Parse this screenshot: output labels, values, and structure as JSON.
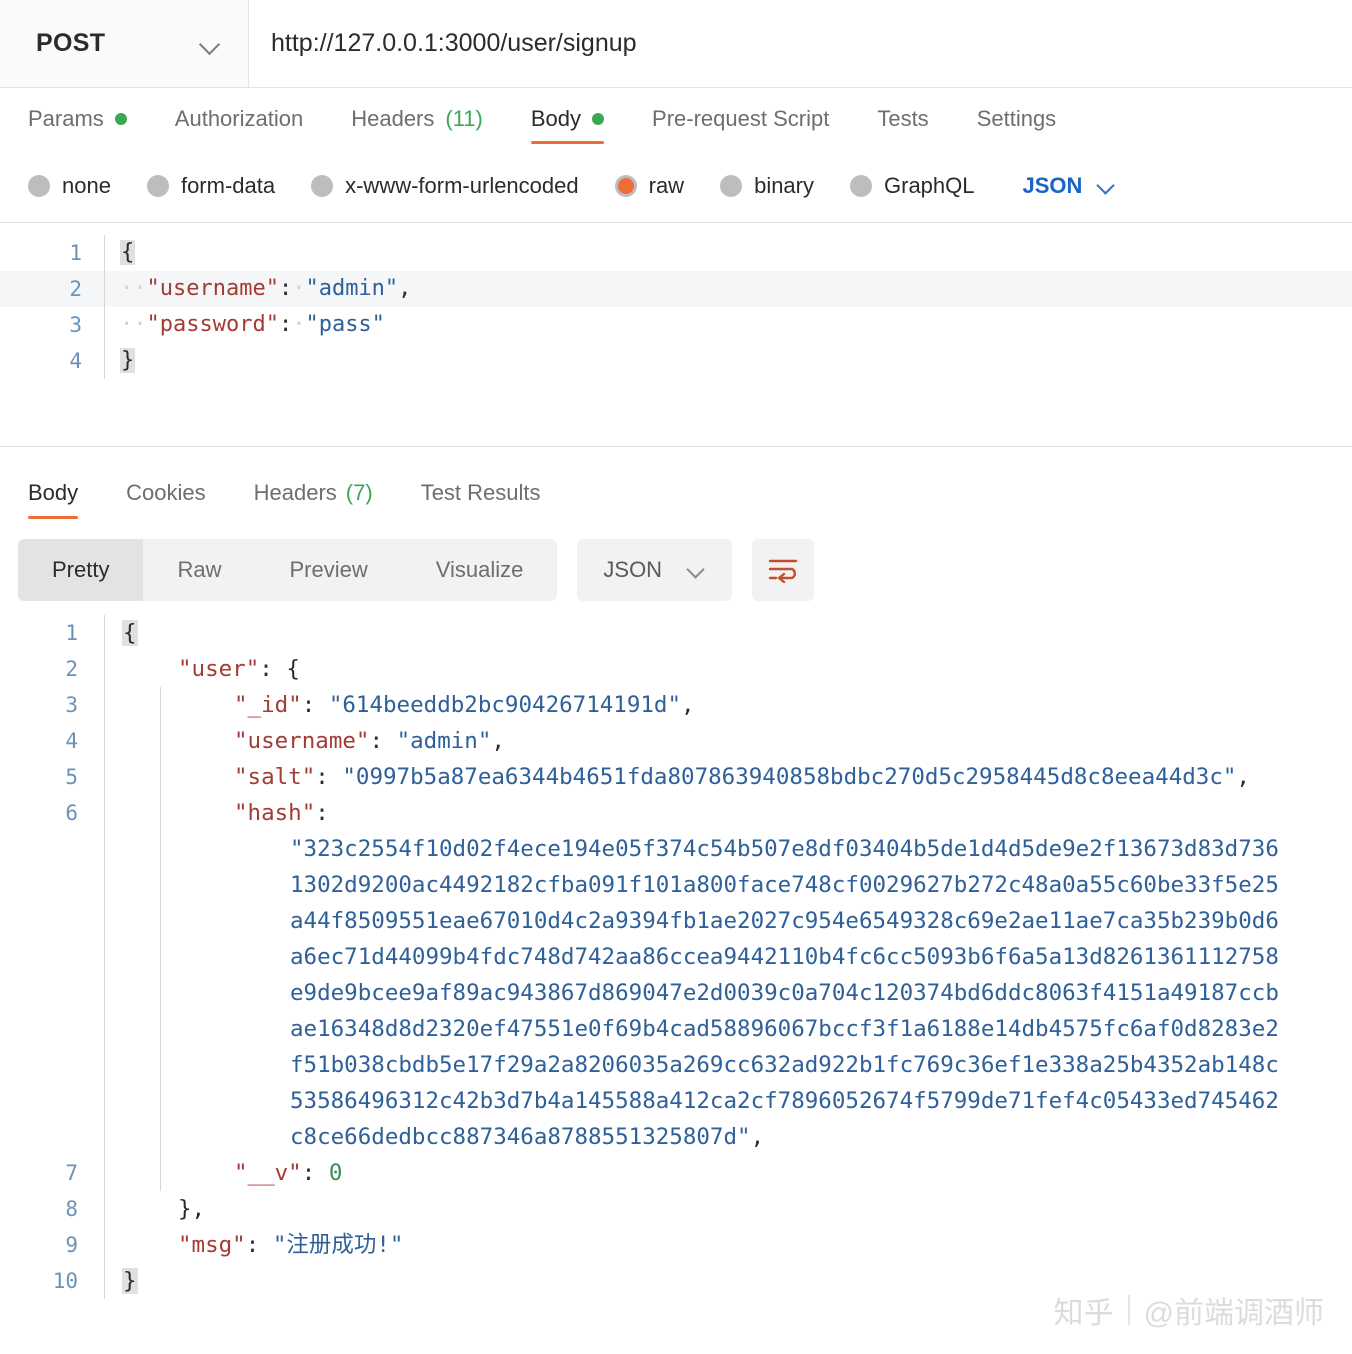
{
  "request": {
    "method": "POST",
    "url": "http://127.0.0.1:3000/user/signup",
    "tabs": [
      {
        "label": "Params",
        "indicator": "dot",
        "active": false
      },
      {
        "label": "Authorization",
        "indicator": "none",
        "active": false
      },
      {
        "label": "Headers",
        "count": "(11)",
        "indicator": "count",
        "active": false
      },
      {
        "label": "Body",
        "indicator": "dot",
        "active": true
      },
      {
        "label": "Pre-request Script",
        "indicator": "none",
        "active": false
      },
      {
        "label": "Tests",
        "indicator": "none",
        "active": false
      },
      {
        "label": "Settings",
        "indicator": "none",
        "active": false
      }
    ],
    "body_types": [
      {
        "label": "none",
        "selected": false
      },
      {
        "label": "form-data",
        "selected": false
      },
      {
        "label": "x-www-form-urlencoded",
        "selected": false
      },
      {
        "label": "raw",
        "selected": true
      },
      {
        "label": "binary",
        "selected": false
      },
      {
        "label": "GraphQL",
        "selected": false
      }
    ],
    "raw_format": "JSON",
    "editor_lines": [
      {
        "num": "1",
        "tokens": [
          {
            "t": "{",
            "c": "fold"
          }
        ]
      },
      {
        "num": "2",
        "highlight": true,
        "tokens": [
          {
            "t": "··",
            "c": "ws"
          },
          {
            "t": "\"username\"",
            "c": "k"
          },
          {
            "t": ":",
            "c": "p"
          },
          {
            "t": "·",
            "c": "ws"
          },
          {
            "t": "\"admin\"",
            "c": "s"
          },
          {
            "t": ",",
            "c": "p"
          }
        ]
      },
      {
        "num": "3",
        "tokens": [
          {
            "t": "··",
            "c": "ws"
          },
          {
            "t": "\"password\"",
            "c": "k"
          },
          {
            "t": ":",
            "c": "p"
          },
          {
            "t": "·",
            "c": "ws"
          },
          {
            "t": "\"pass\"",
            "c": "s"
          }
        ]
      },
      {
        "num": "4",
        "tokens": [
          {
            "t": "}",
            "c": "fold"
          }
        ]
      }
    ]
  },
  "response": {
    "tabs": [
      {
        "label": "Body",
        "active": true
      },
      {
        "label": "Cookies",
        "active": false
      },
      {
        "label": "Headers",
        "count": "(7)",
        "active": false
      },
      {
        "label": "Test Results",
        "active": false
      }
    ],
    "view_modes": [
      {
        "label": "Pretty",
        "active": true
      },
      {
        "label": "Raw",
        "active": false
      },
      {
        "label": "Preview",
        "active": false
      },
      {
        "label": "Visualize",
        "active": false
      }
    ],
    "format": "JSON",
    "wrap_icon": "word-wrap-icon",
    "accent_color": "#ef6c34",
    "lines": [
      {
        "num": "1",
        "indent": 0,
        "level": 0,
        "tokens": [
          {
            "t": "{",
            "c": "fold"
          }
        ]
      },
      {
        "num": "2",
        "indent": 1,
        "level": 1,
        "tokens": [
          {
            "t": "\"user\"",
            "c": "k"
          },
          {
            "t": ": {",
            "c": "p"
          }
        ]
      },
      {
        "num": "3",
        "indent": 2,
        "level": 2,
        "tokens": [
          {
            "t": "\"_id\"",
            "c": "k"
          },
          {
            "t": ": ",
            "c": "p"
          },
          {
            "t": "\"614beeddb2bc90426714191d\"",
            "c": "s"
          },
          {
            "t": ",",
            "c": "p"
          }
        ]
      },
      {
        "num": "4",
        "indent": 2,
        "level": 2,
        "tokens": [
          {
            "t": "\"username\"",
            "c": "k"
          },
          {
            "t": ": ",
            "c": "p"
          },
          {
            "t": "\"admin\"",
            "c": "s"
          },
          {
            "t": ",",
            "c": "p"
          }
        ]
      },
      {
        "num": "5",
        "indent": 2,
        "level": 2,
        "tokens": [
          {
            "t": "\"salt\"",
            "c": "k"
          },
          {
            "t": ": ",
            "c": "p"
          },
          {
            "t": "\"0997b5a87ea6344b4651fda807863940858bdbc270d5c2958445d8c8eea44d3c\"",
            "c": "s"
          },
          {
            "t": ",",
            "c": "p"
          }
        ]
      },
      {
        "num": "6",
        "indent": 2,
        "level": 2,
        "tokens": [
          {
            "t": "\"hash\"",
            "c": "k"
          },
          {
            "t": ":",
            "c": "p"
          }
        ]
      },
      {
        "num": "",
        "indent": 3,
        "level": 2,
        "tokens": [
          {
            "t": "\"323c2554f10d02f4ece194e05f374c54b507e8df03404b5de1d4d5de9e2f13673d83d736",
            "c": "s"
          }
        ]
      },
      {
        "num": "",
        "indent": 3,
        "level": 2,
        "tokens": [
          {
            "t": "1302d9200ac4492182cfba091f101a800face748cf0029627b272c48a0a55c60be33f5e25",
            "c": "s"
          }
        ]
      },
      {
        "num": "",
        "indent": 3,
        "level": 2,
        "tokens": [
          {
            "t": "a44f8509551eae67010d4c2a9394fb1ae2027c954e6549328c69e2ae11ae7ca35b239b0d6",
            "c": "s"
          }
        ]
      },
      {
        "num": "",
        "indent": 3,
        "level": 2,
        "tokens": [
          {
            "t": "a6ec71d44099b4fdc748d742aa86ccea9442110b4fc6cc5093b6f6a5a13d8261361112758",
            "c": "s"
          }
        ]
      },
      {
        "num": "",
        "indent": 3,
        "level": 2,
        "tokens": [
          {
            "t": "e9de9bcee9af89ac943867d869047e2d0039c0a704c120374bd6ddc8063f4151a49187ccb",
            "c": "s"
          }
        ]
      },
      {
        "num": "",
        "indent": 3,
        "level": 2,
        "tokens": [
          {
            "t": "ae16348d8d2320ef47551e0f69b4cad58896067bccf3f1a6188e14db4575fc6af0d8283e2",
            "c": "s"
          }
        ]
      },
      {
        "num": "",
        "indent": 3,
        "level": 2,
        "tokens": [
          {
            "t": "f51b038cbdb5e17f29a2a8206035a269cc632ad922b1fc769c36ef1e338a25b4352ab148c",
            "c": "s"
          }
        ]
      },
      {
        "num": "",
        "indent": 3,
        "level": 2,
        "tokens": [
          {
            "t": "53586496312c42b3d7b4a145588a412ca2cf7896052674f5799de71fef4c05433ed745462",
            "c": "s"
          }
        ]
      },
      {
        "num": "",
        "indent": 3,
        "level": 2,
        "tokens": [
          {
            "t": "c8ce66dedbcc887346a8788551325807d\"",
            "c": "s"
          },
          {
            "t": ",",
            "c": "p"
          }
        ]
      },
      {
        "num": "7",
        "indent": 2,
        "level": 2,
        "tokens": [
          {
            "t": "\"__v\"",
            "c": "k"
          },
          {
            "t": ": ",
            "c": "p"
          },
          {
            "t": "0",
            "c": "n"
          }
        ]
      },
      {
        "num": "8",
        "indent": 1,
        "level": 1,
        "tokens": [
          {
            "t": "},",
            "c": "p"
          }
        ]
      },
      {
        "num": "9",
        "indent": 1,
        "level": 1,
        "tokens": [
          {
            "t": "\"msg\"",
            "c": "k"
          },
          {
            "t": ": ",
            "c": "p"
          },
          {
            "t": "\"注册成功!\"",
            "c": "s"
          }
        ]
      },
      {
        "num": "10",
        "indent": 0,
        "level": 0,
        "tokens": [
          {
            "t": "}",
            "c": "fold"
          }
        ]
      }
    ]
  },
  "watermark": {
    "brand": "知乎",
    "handle": "@前端调酒师"
  }
}
